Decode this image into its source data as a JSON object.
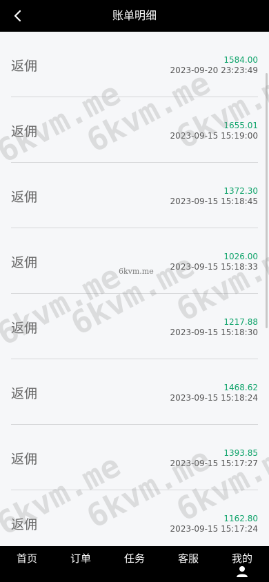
{
  "header": {
    "title": "账单明细",
    "back_icon": "chevron-left-icon"
  },
  "records": [
    {
      "label": "返佣",
      "amount": "1584.00",
      "time": "2023-09-20 23:23:49"
    },
    {
      "label": "返佣",
      "amount": "1655.01",
      "time": "2023-09-15 15:19:00"
    },
    {
      "label": "返佣",
      "amount": "1372.30",
      "time": "2023-09-15 15:18:45"
    },
    {
      "label": "返佣",
      "amount": "1026.00",
      "time": "2023-09-15 15:18:33"
    },
    {
      "label": "返佣",
      "amount": "1217.88",
      "time": "2023-09-15 15:18:30"
    },
    {
      "label": "返佣",
      "amount": "1468.62",
      "time": "2023-09-15 15:18:24"
    },
    {
      "label": "返佣",
      "amount": "1393.85",
      "time": "2023-09-15 15:17:27"
    },
    {
      "label": "返佣",
      "amount": "1162.80",
      "time": "2023-09-15 15:17:24"
    }
  ],
  "watermark": {
    "text": "6kvm.me"
  },
  "tabbar": {
    "items": [
      {
        "label": "首页"
      },
      {
        "label": "订单"
      },
      {
        "label": "任务"
      },
      {
        "label": "客服"
      },
      {
        "label": "我的",
        "icon": "user-icon"
      }
    ]
  },
  "colors": {
    "header_bg": "#000000",
    "amount": "#0ea36a",
    "page_bg": "#f6f7f9"
  }
}
